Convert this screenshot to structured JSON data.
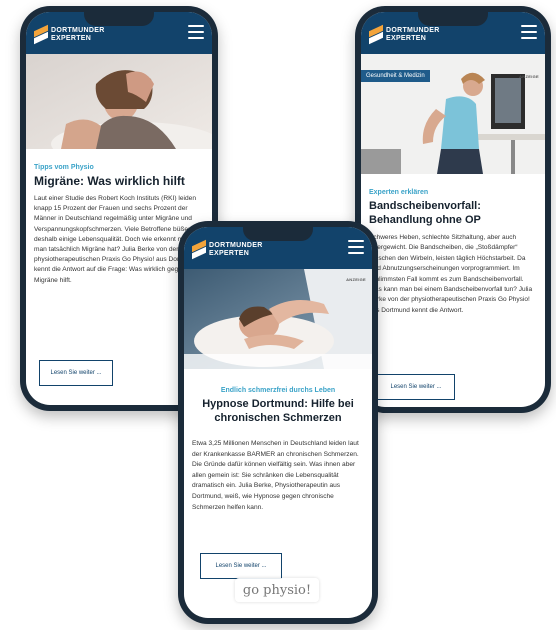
{
  "brand": {
    "line1": "DORTMUNDER",
    "line2": "EXPERTEN",
    "accent_color": "#f3a43b",
    "header_color": "#12436b",
    "kicker_color": "#3ba3c8"
  },
  "phone_left": {
    "kicker": "Tipps vom Physio",
    "title": "Migräne: Was wirklich hilft",
    "text": "Laut einer Studie des Robert Koch Instituts (RKI) leiden knapp 15 Prozent der Frauen und sechs Prozent der Männer in Deutschland regelmäßig unter Migräne und Verspannungskopfschmerzen. Viele Betroffene büßen deshalb einige Lebensqualität. Doch wie erkennt man man tatsächlich Migräne hat? Julia Berke von der physiotherapeutischen Praxis Go Physio! aus Dortmunder kennt die Antwort auf die Frage: Was wirklich gegen Migräne hilft.",
    "button": "Lesen Sie weiter ..."
  },
  "phone_right": {
    "tag": "Gesundheit & Medizin",
    "image_brand": "ANZEIGE",
    "kicker": "Experten erklären",
    "title": "Bandscheibenvorfall: Behandlung ohne OP",
    "text": "Schweres Heben, schlechte Sitzhaltung, aber auch Übergewicht. Die Bandscheiben, die „Stoßdämpfer“ zwischen den Wirbeln, leisten täglich Höchstarbeit. Da sind Abnutzungserscheinungen vorprogrammiert. Im schlimmsten Fall kommt es zum Bandscheibenvorfall. Was kann man bei einem Bandscheibenvorfall tun? Julia Berke von der physiotherapeutischen Praxis Go Physio! aus Dortmund kennt die Antwort.",
    "button": "Lesen Sie weiter ..."
  },
  "phone_center": {
    "image_brand": "ANZEIGE",
    "kicker": "Endlich schmerzfrei durchs Leben",
    "title": "Hypnose Dortmund: Hilfe bei chronischen Schmerzen",
    "text": "Etwa 3,25 Millionen Menschen in Deutschland leiden laut der Krankenkasse BARMER an chronischen Schmerzen. Die Gründe dafür können vielfältig sein. Was ihnen aber allen gemein ist: Sie schränken die Lebensqualität dramatisch ein. Julia Berke, Physiotherapeutin aus Dortmund, weiß, wie Hypnose gegen chronische Schmerzen helfen kann.",
    "button": "Lesen Sie weiter ..."
  },
  "watermark": "go physio!"
}
